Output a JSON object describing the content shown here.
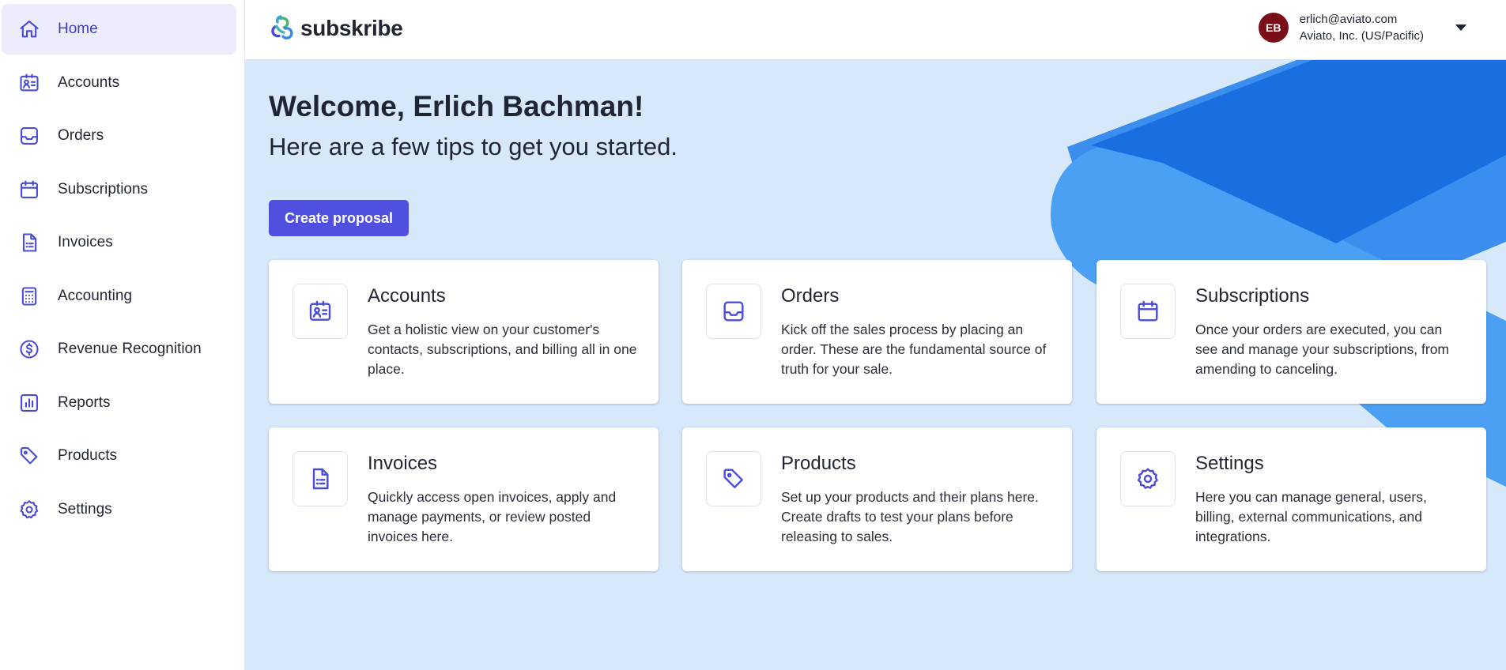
{
  "app": {
    "brand": "subskribe"
  },
  "colors": {
    "accent": "#4f4fe0",
    "sidebar_active_bg": "#ececfb",
    "main_bg": "#d8e8fb",
    "avatar_bg": "#7a0d17"
  },
  "sidebar": {
    "items": [
      {
        "label": "Home",
        "icon": "home-icon",
        "active": true
      },
      {
        "label": "Accounts",
        "icon": "contact-card-icon"
      },
      {
        "label": "Orders",
        "icon": "inbox-icon"
      },
      {
        "label": "Subscriptions",
        "icon": "calendar-icon"
      },
      {
        "label": "Invoices",
        "icon": "document-icon"
      },
      {
        "label": "Accounting",
        "icon": "calculator-icon"
      },
      {
        "label": "Revenue Recognition",
        "icon": "dollar-icon"
      },
      {
        "label": "Reports",
        "icon": "bar-chart-icon"
      },
      {
        "label": "Products",
        "icon": "tag-icon"
      },
      {
        "label": "Settings",
        "icon": "gear-icon"
      }
    ]
  },
  "header": {
    "user": {
      "initials": "EB",
      "email": "erlich@aviato.com",
      "org": "Aviato, Inc. (US/Pacific)"
    }
  },
  "main": {
    "welcome": "Welcome, Erlich Bachman!",
    "subtitle": "Here are a few tips to get you started.",
    "create_button": "Create proposal",
    "cards": [
      {
        "title": "Accounts",
        "icon": "contact-card-icon",
        "desc": "Get a holistic view on your customer's contacts, subscriptions, and billing all in one place."
      },
      {
        "title": "Orders",
        "icon": "inbox-icon",
        "desc": "Kick off the sales process by placing an order. These are the fundamental source of truth for your sale."
      },
      {
        "title": "Subscriptions",
        "icon": "calendar-icon",
        "desc": "Once your orders are executed, you can see and manage your subscriptions, from amending to canceling."
      },
      {
        "title": "Invoices",
        "icon": "document-icon",
        "desc": "Quickly access open invoices, apply and manage payments, or review posted invoices here."
      },
      {
        "title": "Products",
        "icon": "tag-icon",
        "desc": "Set up your products and their plans here. Create drafts to test your plans before releasing to sales."
      },
      {
        "title": "Settings",
        "icon": "gear-icon",
        "desc": "Here you can manage general, users, billing, external communications, and integrations."
      }
    ]
  }
}
